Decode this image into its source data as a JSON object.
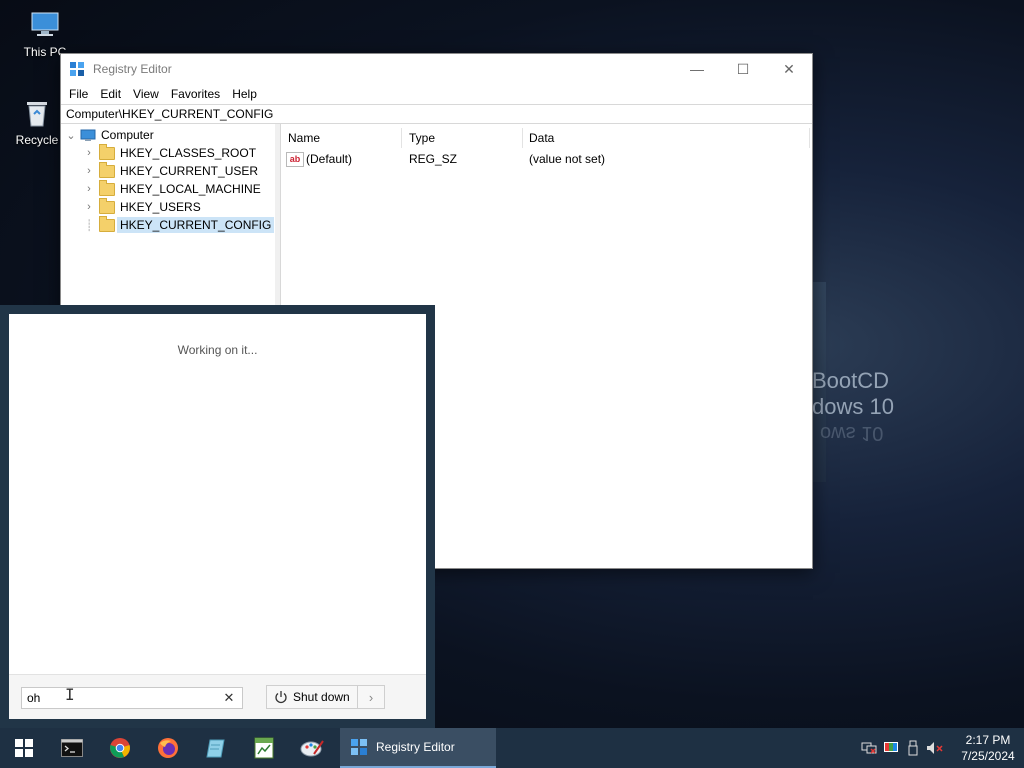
{
  "desktop": {
    "icons": [
      {
        "label": "This PC",
        "icon": "computer-icon"
      },
      {
        "label": "Recycle",
        "icon": "recycle-bin-icon"
      }
    ],
    "wallpaper_text": {
      "line1": "BootCD",
      "line2": "dows 10",
      "mirror": "ows 10"
    }
  },
  "registry": {
    "title": "Registry Editor",
    "controls": {
      "minimize": "—",
      "maximize": "☐",
      "close": "✕"
    },
    "menu": [
      "File",
      "Edit",
      "View",
      "Favorites",
      "Help"
    ],
    "address": "Computer\\HKEY_CURRENT_CONFIG",
    "tree": {
      "root": "Computer",
      "children": [
        "HKEY_CLASSES_ROOT",
        "HKEY_CURRENT_USER",
        "HKEY_LOCAL_MACHINE",
        "HKEY_USERS",
        "HKEY_CURRENT_CONFIG"
      ],
      "selected": "HKEY_CURRENT_CONFIG"
    },
    "columns": [
      "Name",
      "Type",
      "Data"
    ],
    "values": [
      {
        "name": "(Default)",
        "type": "REG_SZ",
        "data": "(value not set)",
        "icon": "ab"
      }
    ]
  },
  "start_panel": {
    "status": "Working on it...",
    "search_value": "oh",
    "clear_glyph": "✕",
    "shutdown_label": "Shut down",
    "arrow_glyph": "›"
  },
  "taskbar": {
    "apps": [
      "cmd-icon",
      "chrome-icon",
      "firefox-icon",
      "notepad-icon",
      "spreadsheet-icon",
      "paint-icon"
    ],
    "active_window": "Registry Editor",
    "clock": {
      "time": "2:17 PM",
      "date": "7/25/2024"
    }
  }
}
